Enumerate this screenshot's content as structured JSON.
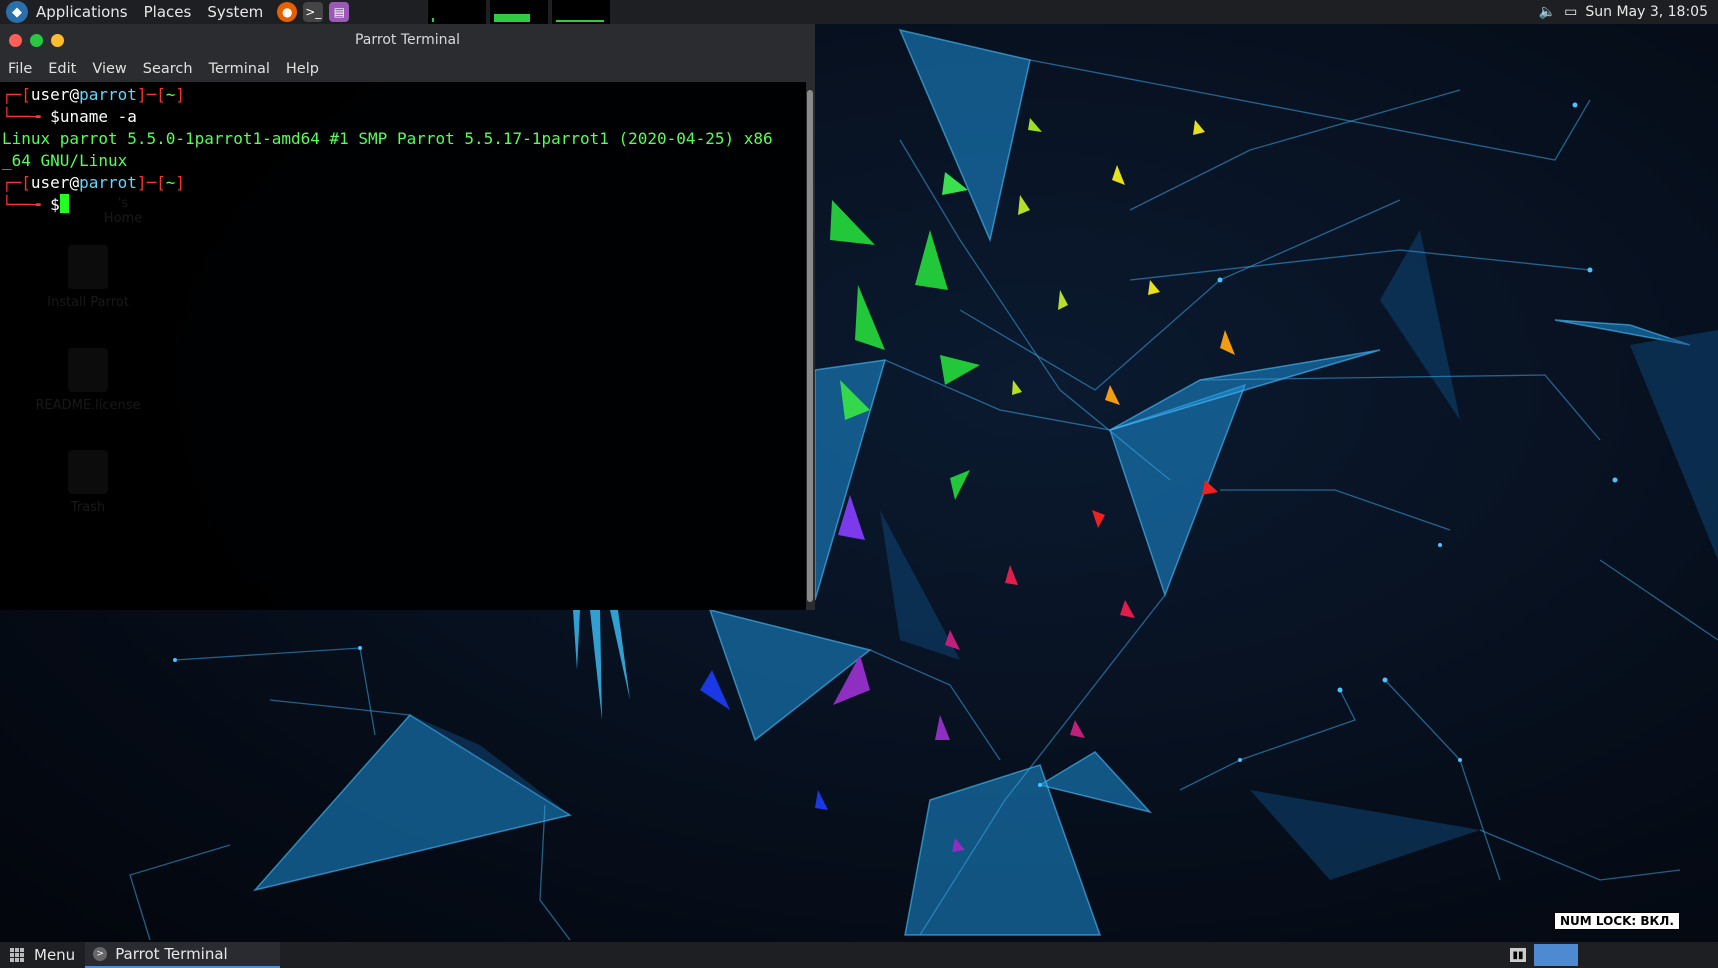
{
  "top_panel": {
    "menus": [
      "Applications",
      "Places",
      "System"
    ],
    "clock": "Sun May 3, 18:05"
  },
  "terminal": {
    "title": "Parrot Terminal",
    "menu": [
      "File",
      "Edit",
      "View",
      "Search",
      "Terminal",
      "Help"
    ],
    "prompt": {
      "user": "user",
      "at": "@",
      "host": "parrot",
      "dir": "~",
      "symbol": "$"
    },
    "command": "uname -a",
    "output": [
      "Linux parrot 5.5.0-1parrot1-amd64 #1 SMP Parrot 5.5.17-1parrot1 (2020-04-25) x86",
      "_64 GNU/Linux"
    ]
  },
  "desktop_icons": [
    "'s Home",
    "Install Parrot",
    "README.license",
    "Trash"
  ],
  "num_lock": "NUM LOCK: ВКЛ.",
  "bottom_panel": {
    "menu_label": "Menu",
    "task_label": "Parrot Terminal"
  },
  "colors": {
    "prompt_red": "#ff3030",
    "output_green": "#55ff55",
    "panel_bg": "#1e1f23"
  }
}
